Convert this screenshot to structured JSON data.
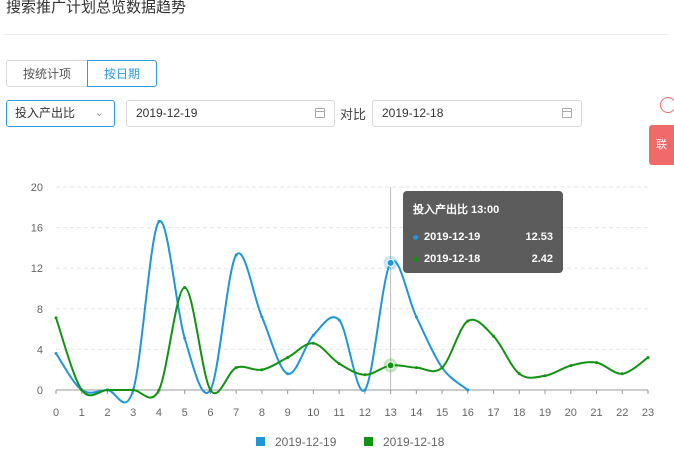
{
  "header": {
    "title": "搜索推广计划总览数据趋势"
  },
  "tabs": [
    {
      "label": "按统计项",
      "active": false
    },
    {
      "label": "按日期",
      "active": true
    }
  ],
  "metric_select": {
    "value": "投入产出比"
  },
  "date_a": {
    "value": "2019-12-19"
  },
  "compare_label": "对比",
  "date_b": {
    "value": "2019-12-18"
  },
  "side_widget": {
    "label": "联"
  },
  "colors": {
    "accent": "#2d9bdb",
    "series_a": "#1f96d9",
    "series_b": "#129212",
    "side": "#f06a6a"
  },
  "icons": {
    "chevron": "chevron-down-icon",
    "calendar": "calendar-icon"
  },
  "tooltip": {
    "title": "投入产出比 13:00",
    "rows": [
      {
        "name": "2019-12-19",
        "value": "12.53"
      },
      {
        "name": "2019-12-18",
        "value": "2.42"
      }
    ]
  },
  "chart_data": {
    "type": "line",
    "x": [
      "0",
      "1",
      "2",
      "3",
      "4",
      "5",
      "6",
      "7",
      "8",
      "9",
      "10",
      "11",
      "12",
      "13",
      "14",
      "15",
      "16",
      "17",
      "18",
      "19",
      "20",
      "21",
      "22",
      "23"
    ],
    "ylim": [
      0,
      20
    ],
    "yticks": [
      0,
      4,
      8,
      12,
      16,
      20
    ],
    "grid": true,
    "legend_position": "bottom",
    "series": [
      {
        "name": "2019-12-19",
        "values": [
          3.6,
          0,
          0,
          0,
          16.6,
          5.1,
          0,
          13.3,
          7.2,
          1.6,
          5.4,
          6.9,
          0,
          12.53,
          7.2,
          2.2,
          0,
          null,
          null,
          null,
          null,
          null,
          null,
          null
        ]
      },
      {
        "name": "2019-12-18",
        "values": [
          7.1,
          0,
          0,
          0,
          0,
          10.1,
          0,
          2.2,
          2.0,
          3.2,
          4.6,
          2.6,
          1.5,
          2.42,
          2.2,
          2.2,
          6.8,
          5.3,
          1.6,
          1.4,
          2.4,
          2.7,
          1.6,
          3.2
        ]
      }
    ],
    "highlight_index": 13
  }
}
